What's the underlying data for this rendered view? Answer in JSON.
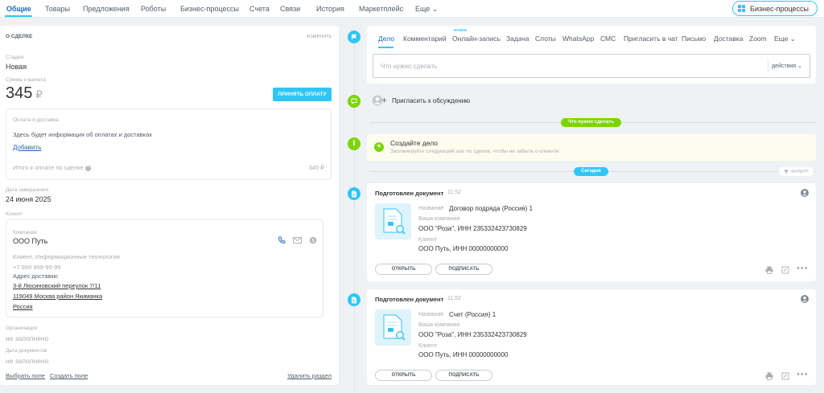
{
  "top_tabs": [
    {
      "label": "Общие",
      "active": true
    },
    {
      "label": "Товары"
    },
    {
      "label": "Предложения"
    },
    {
      "label": "Роботы"
    },
    {
      "label": "Бизнес-процессы"
    },
    {
      "label": "Счета"
    },
    {
      "label": "Связи"
    },
    {
      "label": "История"
    },
    {
      "label": "Маркетплейс"
    },
    {
      "label": "Еще"
    }
  ],
  "bp_button": "Бизнес-процессы",
  "deal": {
    "section_title": "О сделке",
    "edit": "изменить",
    "stage_label": "Стадия",
    "stage": "Новая",
    "amount_label": "Сумма и валюта",
    "amount": "345",
    "currency": "₽",
    "accept_payment": "ПРИНЯТЬ ОПЛАТУ",
    "payment_label": "Оплата и доставка",
    "payment_placeholder": "Здесь будет информация об оплатах и доставках",
    "add": "Добавить",
    "total_label": "Итого к оплате по сделке",
    "total": "345 ₽",
    "close_date_label": "Дата завершения",
    "close_date": "24 июня 2025",
    "client_label": "Клиент",
    "company_label": "Компания",
    "company": "ООО Путь",
    "client_type": "Клиент, Информационные технологии",
    "phone": "+7 999 999-99-99",
    "address_label": "Адрес доставки:",
    "address_line1": "3-й Люсиновский переулок 7/11",
    "address_line2": "119049 Москва район Якиманка",
    "address_line3": "Россия",
    "org_label": "Организация",
    "org_value": "не заполнено",
    "docs_date_label": "Дата документов",
    "docs_date_value": "не заполнено",
    "choose_field": "Выбрать поле",
    "create_field": "Создать поле",
    "delete_section": "Удалить раздел"
  },
  "activity": {
    "tabs": [
      {
        "label": "Дело",
        "active": true
      },
      {
        "label": "Комментарий"
      },
      {
        "label": "Онлайн-запись",
        "badge": "НОВОЕ"
      },
      {
        "label": "Задача"
      },
      {
        "label": "Слоты"
      },
      {
        "label": "WhatsApp"
      },
      {
        "label": "СМС"
      },
      {
        "label": "Пригласить в чат"
      },
      {
        "label": "Письмо"
      },
      {
        "label": "Доставка"
      },
      {
        "label": "Zoom"
      },
      {
        "label": "Еще"
      }
    ],
    "input_placeholder": "Что нужно сделать",
    "actions": "действия",
    "invite": "Пригласить к обсуждению",
    "todo_pill": "Что нужно сделать",
    "create_task_title": "Создайте дело",
    "create_task_sub": "Запланируйте следующий шаг по сделке, чтобы не забыть о клиенте",
    "today_pill": "Сегодня",
    "filter": "ФИЛЬТР"
  },
  "documents": [
    {
      "title": "Подготовлен документ",
      "time": "11:52",
      "name_label": "Название",
      "name": "Договор подряда (Россия) 1",
      "company_label": "Ваша компания",
      "company": "ООО \"Роза\", ИНН 235332423730829",
      "client_label": "Клиент",
      "client": "ООО Путь, ИНН 00000000000",
      "open": "ОТКРЫТЬ",
      "sign": "ПОДПИСАТЬ"
    },
    {
      "title": "Подготовлен документ",
      "time": "11:52",
      "name_label": "Название",
      "name": "Счет (Россия) 1",
      "company_label": "Ваша компания",
      "company": "ООО \"Роза\", ИНН 235332423730829",
      "client_label": "Клиент",
      "client": "ООО Путь, ИНН 00000000000",
      "open": "ОТКРЫТЬ",
      "sign": "ПОДПИСАТЬ"
    }
  ],
  "colors": {
    "accent": "#2fc6f6",
    "link": "#2067b0",
    "green": "#7bd500",
    "todo_bg": "#fefcee"
  }
}
